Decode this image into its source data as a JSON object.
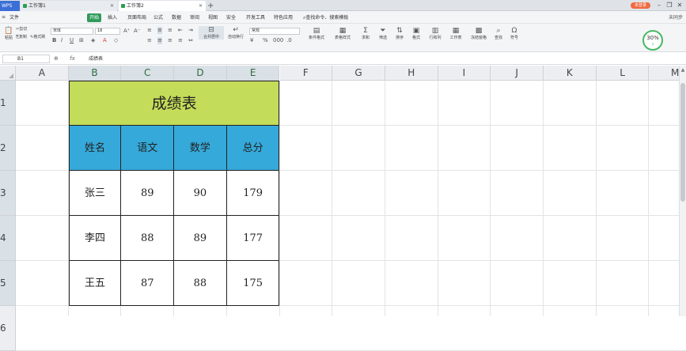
{
  "titlebar": {
    "app_tab": "WPS",
    "tab1_label": "工作簿1",
    "tab2_label": "工作簿2",
    "add_tab": "+",
    "login_label": "未登录"
  },
  "menubar": {
    "items": [
      "文件",
      "开始",
      "插入",
      "页面布局",
      "公式",
      "数据",
      "审阅",
      "视图",
      "安全",
      "开发工具",
      "特色应用"
    ],
    "search_label": "查找命令、搜索模板",
    "right_label": "未同步"
  },
  "ribbon": {
    "paste": "粘贴",
    "cut": "剪切",
    "copy": "复制",
    "format_painter": "格式刷",
    "font_name": "宋体",
    "font_size": "18",
    "merge_center": "合并居中",
    "wrap_text": "自动换行",
    "number_format": "常规",
    "cond_format": "条件格式",
    "table_style": "表格样式",
    "sum": "求和",
    "filter": "筛选",
    "sort": "排序",
    "format": "格式",
    "row_col": "行和列",
    "worksheet": "工作表",
    "freeze": "冻结窗格",
    "find": "查找",
    "symbol": "符号",
    "progress": "30%"
  },
  "formula_bar": {
    "cell_ref": "B1",
    "fx": "fx",
    "content": "成绩表"
  },
  "sheet": {
    "columns": [
      "A",
      "B",
      "C",
      "D",
      "E",
      "F",
      "G",
      "H",
      "I",
      "J",
      "K",
      "L",
      "M"
    ],
    "rows": [
      "1",
      "2",
      "3",
      "4",
      "5",
      "6"
    ],
    "title": "成绩表",
    "headers": [
      "姓名",
      "语文",
      "数学",
      "总分"
    ],
    "records": [
      [
        "张三",
        "89",
        "90",
        "179"
      ],
      [
        "李四",
        "88",
        "89",
        "177"
      ],
      [
        "王五",
        "87",
        "88",
        "175"
      ]
    ]
  }
}
